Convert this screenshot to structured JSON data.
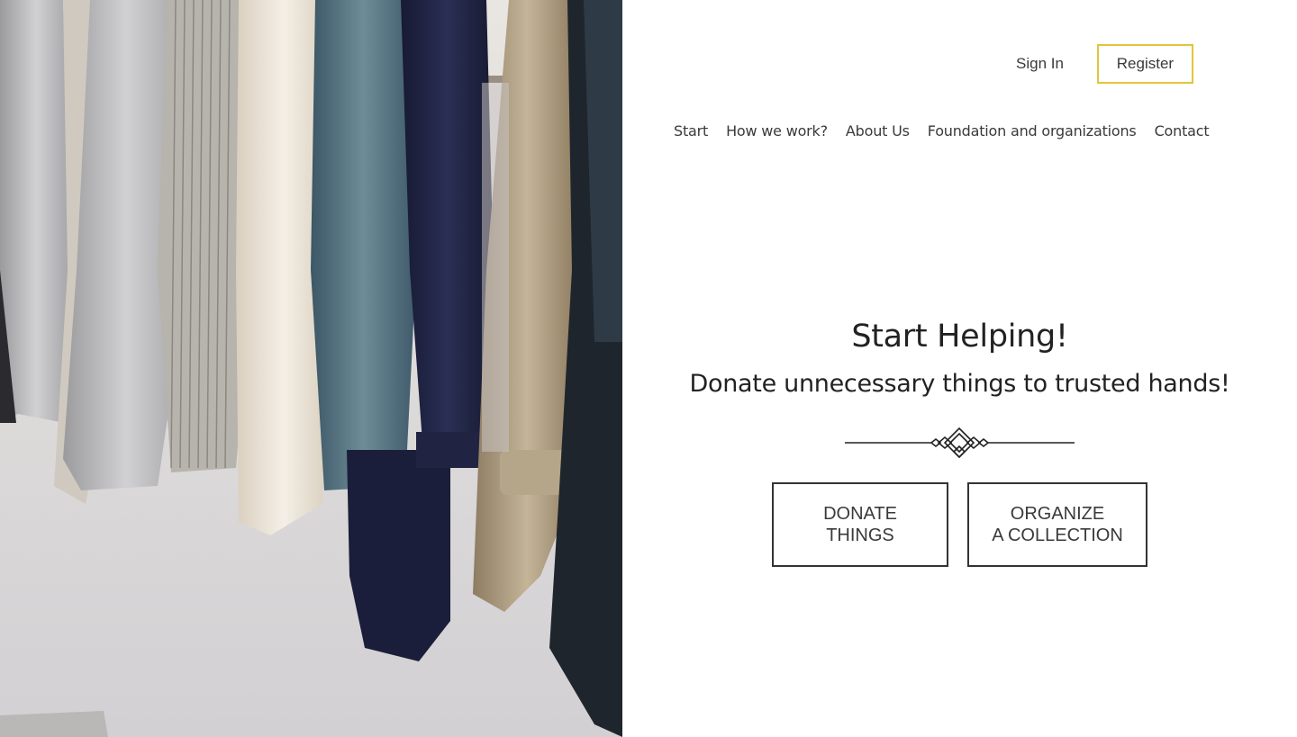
{
  "auth": {
    "signin_label": "Sign In",
    "register_label": "Register",
    "register_border_color": "#e3c43a"
  },
  "nav": {
    "items": [
      {
        "label": "Start"
      },
      {
        "label": "How we work?"
      },
      {
        "label": "About Us"
      },
      {
        "label": "Foundation and organizations"
      },
      {
        "label": "Contact"
      }
    ]
  },
  "hero": {
    "title": "Start Helping!",
    "subtitle": "Donate unnecessary things to trusted hands!",
    "decoration_icon": "ornament-divider-icon",
    "image_icon": "clothes-rack-photo"
  },
  "cta": {
    "donate": {
      "line1": "DONATE",
      "line2": "THINGS"
    },
    "organize": {
      "line1": "ORGANIZE",
      "line2": "A COLLECTION"
    }
  }
}
